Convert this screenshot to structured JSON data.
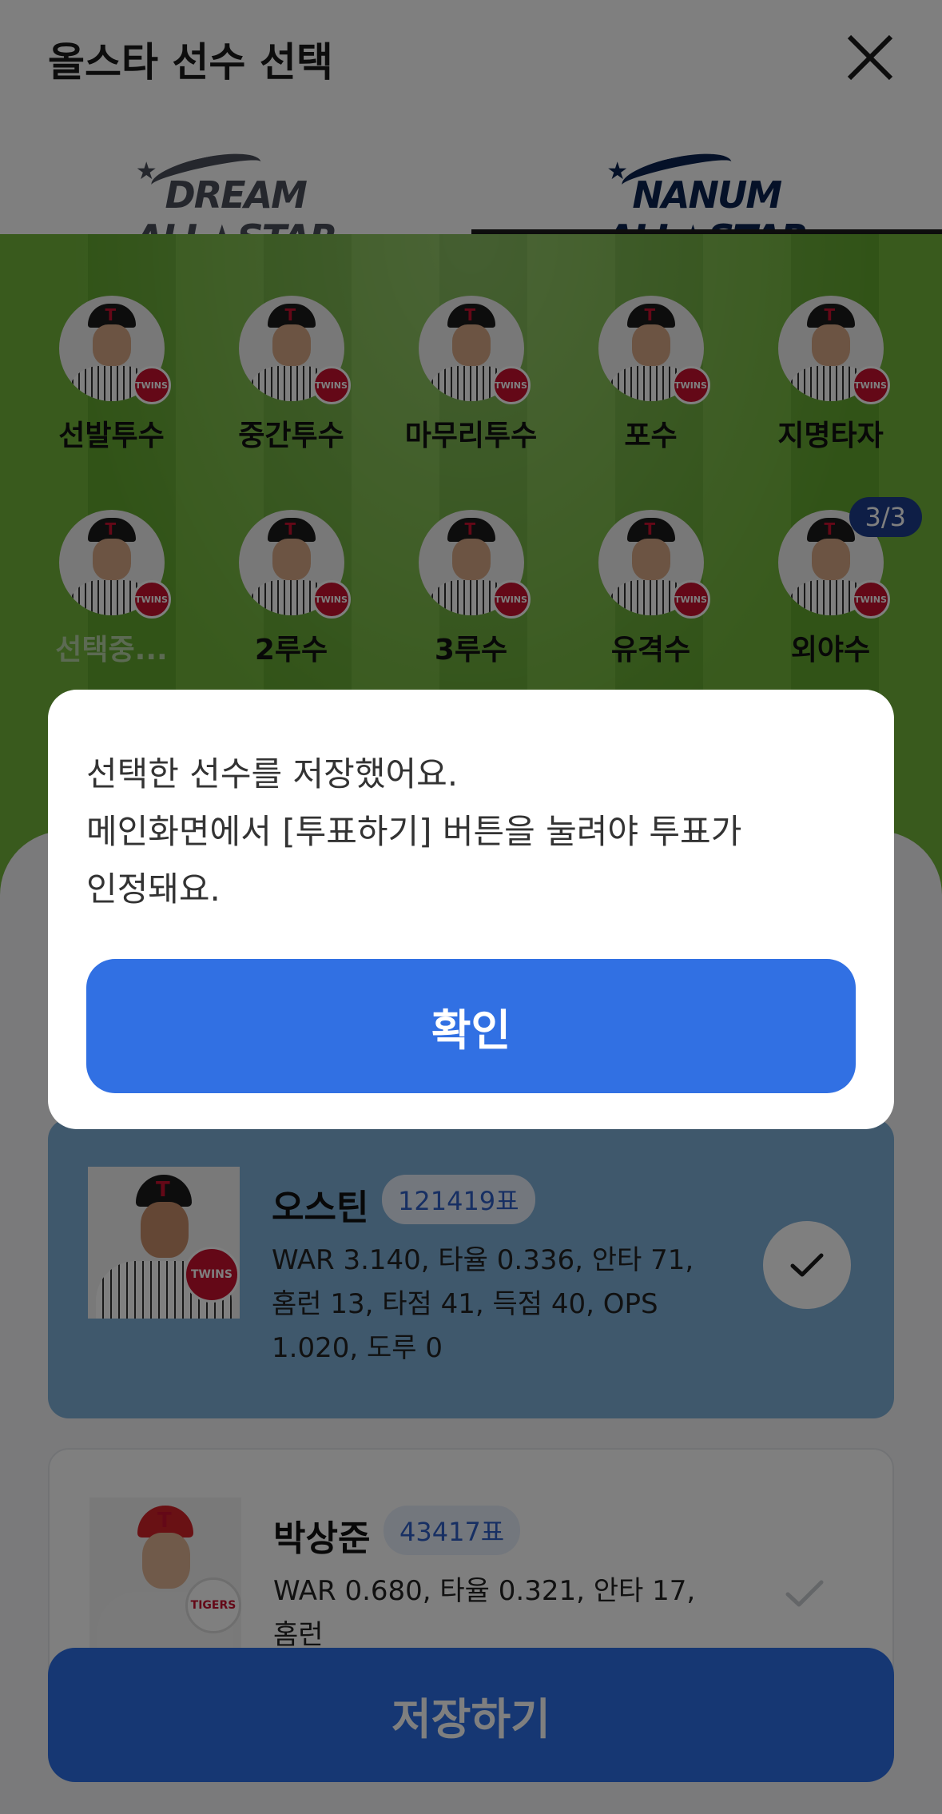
{
  "header": {
    "title": "올스타 선수 선택",
    "close_icon": "close-icon"
  },
  "tabs": [
    {
      "name": "DREAM ALL★STAR",
      "active": false
    },
    {
      "name": "NANUM ALL★STAR",
      "active": true
    }
  ],
  "positions": {
    "row1": [
      {
        "label": "선발투수"
      },
      {
        "label": "중간투수"
      },
      {
        "label": "마무리투수"
      },
      {
        "label": "포수"
      },
      {
        "label": "지명타자"
      }
    ],
    "row2": [
      {
        "label": "선택중..."
      },
      {
        "label": "2루수"
      },
      {
        "label": "3루수"
      },
      {
        "label": "유격수"
      },
      {
        "label": "외야수",
        "count": "3/3"
      }
    ],
    "team_badge": "TWINS"
  },
  "players": [
    {
      "name": "오스틴",
      "votes": "121419표",
      "stats": "WAR 3.140, 타율 0.336, 안타 71, 홈런 13, 타점 41, 득점 40, OPS 1.020, 도루 0",
      "badge": "TWINS",
      "selected": true
    },
    {
      "name": "박상준",
      "votes": "43417표",
      "stats": "WAR 0.680, 타율 0.321, 안타 17, 홈런",
      "badge": "TIGERS",
      "selected": false
    }
  ],
  "save_button": "저장하기",
  "modal": {
    "lines": [
      "선택한 선수를 저장했어요.",
      "메인화면에서 [투표하기] 버튼을 눌려야 투표가",
      "인정돼요."
    ],
    "confirm": "확인"
  },
  "colors": {
    "primary": "#3170e3",
    "field_green": "#72b53b",
    "lg_red": "#c8102e",
    "count_badge": "#1c3d8c"
  }
}
